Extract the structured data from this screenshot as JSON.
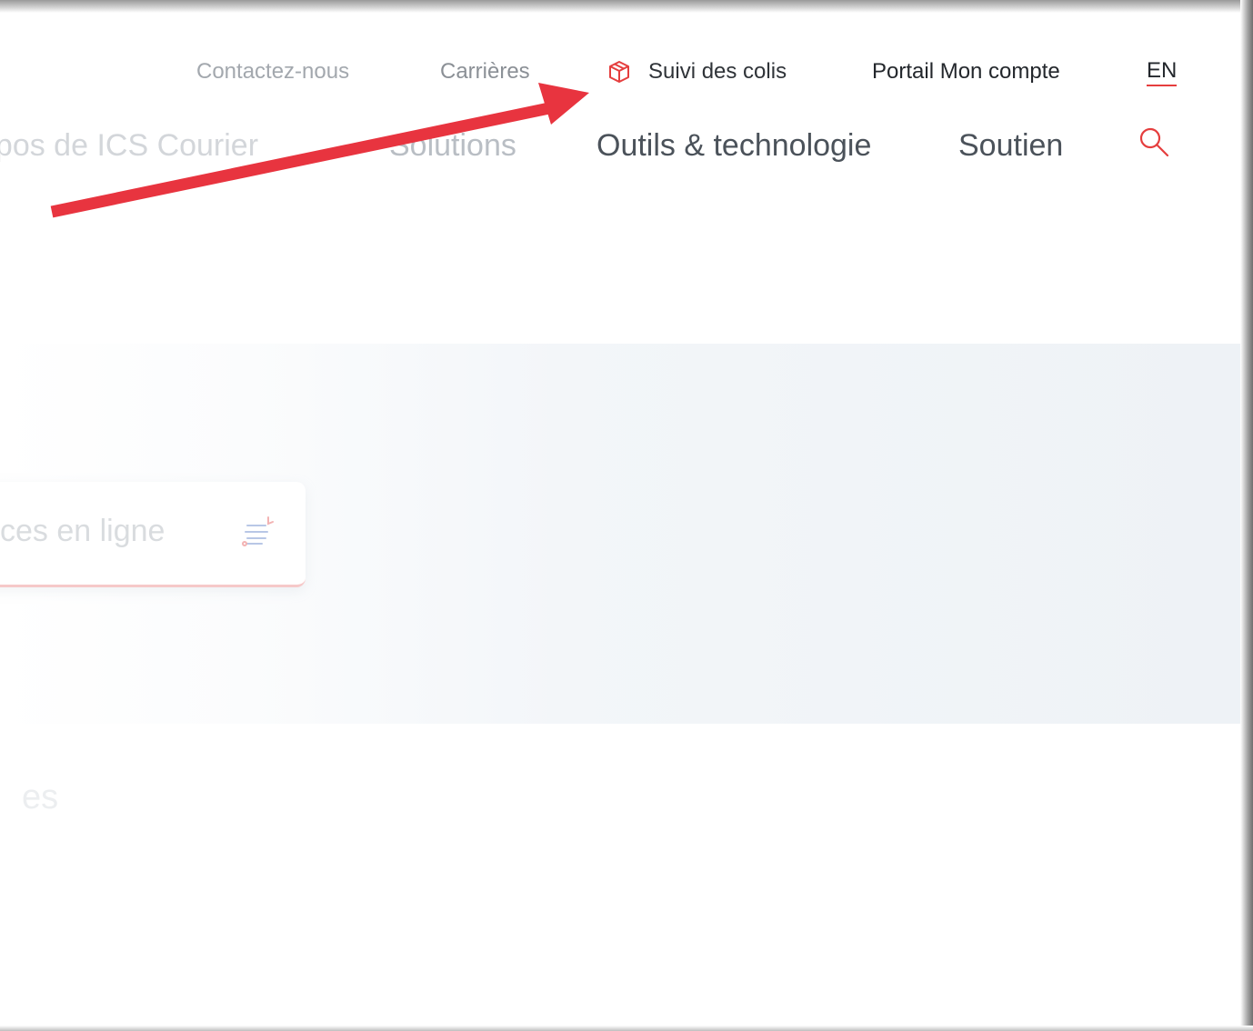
{
  "utility_nav": {
    "contact": "Contactez-nous",
    "careers": "Carrières",
    "tracking": "Suivi des colis",
    "portal": "Portail Mon compte",
    "language": "EN"
  },
  "main_nav": {
    "about": "opos de ICS Courier",
    "solutions": "Solutions",
    "tools": "Outils & technologie",
    "support": "Soutien"
  },
  "hero": {
    "service_label": "ces en ligne"
  },
  "section": {
    "heading_fragment": "es"
  },
  "colors": {
    "accent": "#e53e3e",
    "arrow": "#e8343f",
    "hero_background": "#eef2f6"
  },
  "icons": {
    "tracking": "package-box-icon",
    "search": "search-icon",
    "service": "online-services-icon"
  }
}
